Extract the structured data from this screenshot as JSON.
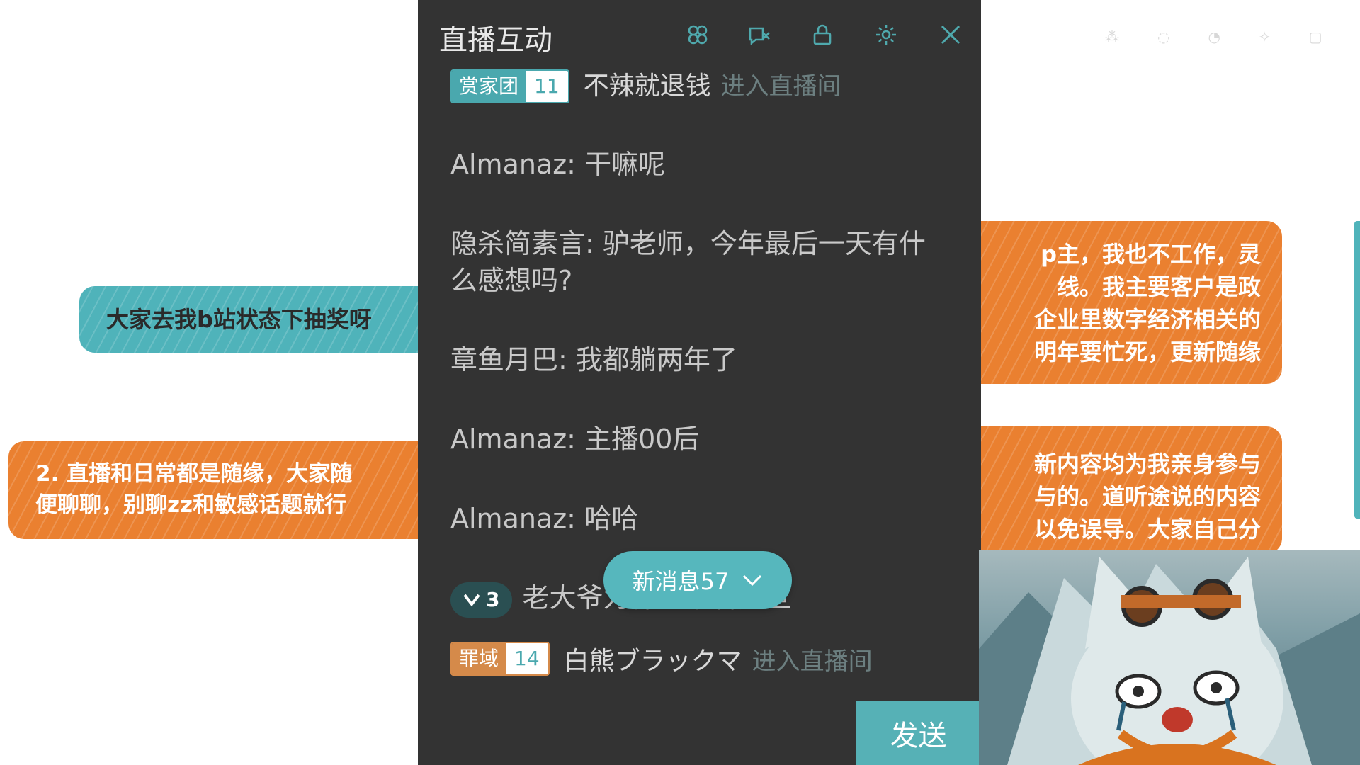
{
  "overlays": {
    "lottery": "大家去我b站状态下抽奖呀",
    "chat_rules": [
      "2. 直播和日常都是随缘，大家随",
      "便聊聊，别聊zz和敏感话题就行"
    ],
    "right_top": [
      "p主，我也不工作，灵",
      "线。我主要客户是政",
      "企业里数字经济相关的",
      "明年要忙死，更新随缘"
    ],
    "right_bottom": [
      "新内容均为我亲身参与",
      "与的。道听途说的内容",
      "以免误导。大家自己分"
    ]
  },
  "panel": {
    "title": "直播互动",
    "icons": [
      "gift-icon",
      "mute-icon",
      "lock-icon",
      "settings-icon",
      "close-icon"
    ]
  },
  "messages": [
    {
      "type": "enter",
      "badge_name": "赏家团",
      "badge_level": "11",
      "user": "不辣就退钱",
      "hint": "进入直播间"
    },
    {
      "type": "chat",
      "user": "Almanaz",
      "text": "干嘛呢"
    },
    {
      "type": "chat",
      "user": "隐杀简素言",
      "text": "驴老师，今年最后一天有什么感想吗?"
    },
    {
      "type": "chat",
      "user": "章鱼月巴",
      "text": "我都躺两年了"
    },
    {
      "type": "chat",
      "user": "Almanaz",
      "text": "主播00后"
    },
    {
      "type": "chat",
      "user": "Almanaz",
      "text": "哈哈"
    },
    {
      "type": "guard",
      "guard_level": "3",
      "text": "老大爷为什么不看元旦"
    }
  ],
  "new_messages": {
    "label": "新消息57"
  },
  "bottom_enter": {
    "badge_name": "罪域",
    "badge_level": "14",
    "user": "白熊ブラックマ",
    "hint": "进入直播间"
  },
  "send_label": "发送"
}
